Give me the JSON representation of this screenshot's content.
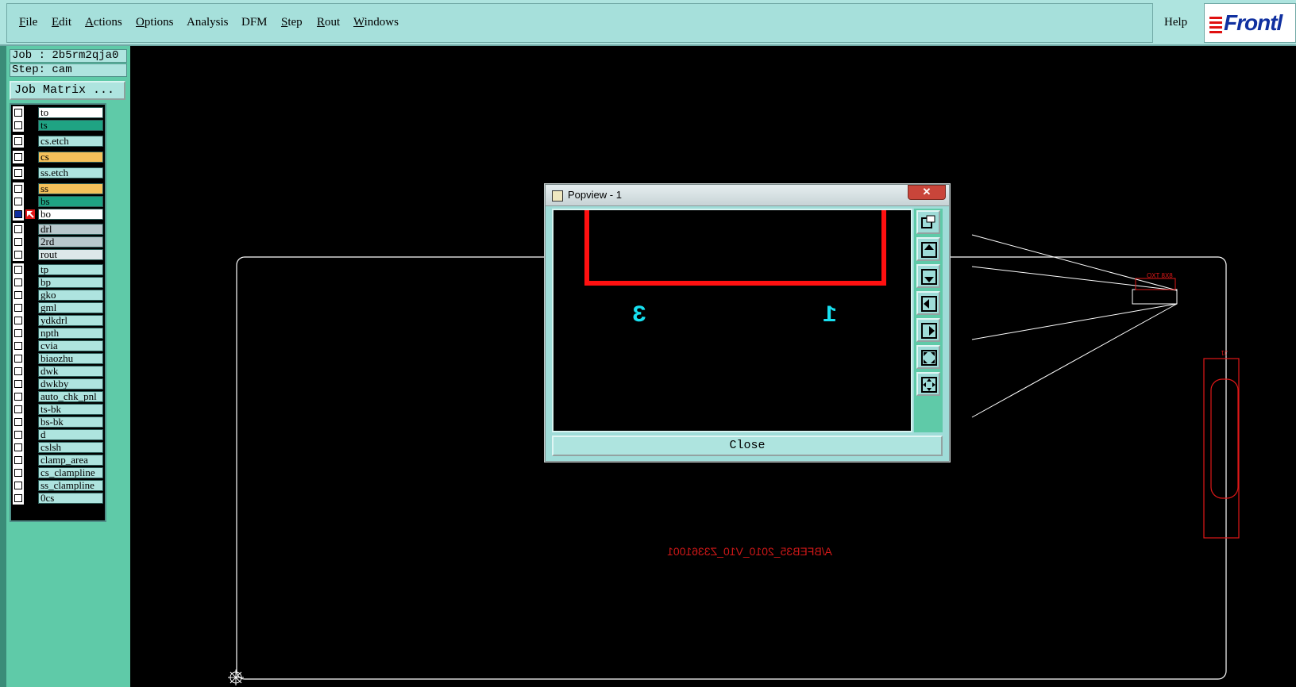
{
  "menubar": {
    "items": [
      {
        "label": "File",
        "u": "F",
        "rest": "ile"
      },
      {
        "label": "Edit",
        "u": "E",
        "rest": "dit"
      },
      {
        "label": "Actions",
        "u": "A",
        "rest": "ctions"
      },
      {
        "label": "Options",
        "u": "O",
        "rest": "ptions"
      },
      {
        "label": "Analysis",
        "u": "",
        "rest": "Analysis"
      },
      {
        "label": "DFM",
        "u": "",
        "rest": "DFM"
      },
      {
        "label": "Step",
        "u": "S",
        "rest": "tep"
      },
      {
        "label": "Rout",
        "u": "R",
        "rest": "out"
      },
      {
        "label": "Windows",
        "u": "W",
        "rest": "indows"
      }
    ],
    "help": "Help",
    "logo_text": "Frontl"
  },
  "job": {
    "job_line": "Job : 2b5rm2qja0",
    "step_line": "Step: cam",
    "matrix_button": "Job Matrix ..."
  },
  "layers": [
    {
      "name": "to",
      "color": "#ffffff"
    },
    {
      "name": "ts",
      "color": "#1fa383"
    },
    {
      "name": "cs.etch",
      "color": "#aee4df"
    },
    {
      "name": "cs",
      "color": "#f5c15a"
    },
    {
      "name": "ss.etch",
      "color": "#aee4df"
    },
    {
      "name": "ss",
      "color": "#f5c15a"
    },
    {
      "name": "bs",
      "color": "#1fa383"
    },
    {
      "name": "bo",
      "color": "#ffffff",
      "active": true
    },
    {
      "name": "drl",
      "color": "#b8c8cc"
    },
    {
      "name": "2rd",
      "color": "#b8c8cc"
    },
    {
      "name": "rout",
      "color": "#dce8ea"
    },
    {
      "name": "tp",
      "color": "#aee4df"
    },
    {
      "name": "bp",
      "color": "#aee4df"
    },
    {
      "name": "gko",
      "color": "#aee4df"
    },
    {
      "name": "gml",
      "color": "#aee4df"
    },
    {
      "name": "ydkdrl",
      "color": "#aee4df"
    },
    {
      "name": "npth",
      "color": "#aee4df"
    },
    {
      "name": "cvia",
      "color": "#aee4df"
    },
    {
      "name": "biaozhu",
      "color": "#aee4df"
    },
    {
      "name": "dwk",
      "color": "#aee4df"
    },
    {
      "name": "dwkby",
      "color": "#aee4df"
    },
    {
      "name": "auto_chk_pnl",
      "color": "#aee4df"
    },
    {
      "name": "ts-bk",
      "color": "#aee4df"
    },
    {
      "name": "bs-bk",
      "color": "#aee4df"
    },
    {
      "name": "d",
      "color": "#aee4df"
    },
    {
      "name": "cslsh",
      "color": "#aee4df"
    },
    {
      "name": "clamp_area",
      "color": "#aee4df"
    },
    {
      "name": "cs_clampline",
      "color": "#aee4df"
    },
    {
      "name": "ss_clampline",
      "color": "#aee4df"
    },
    {
      "name": "0cs",
      "color": "#aee4df"
    }
  ],
  "canvas": {
    "board_text": "A/BFEB35_2010_V10_Z3361001",
    "outline_color": "#ffffff",
    "feature_color": "#e01818",
    "label_small_1": "OXT 8X8",
    "label_small_2": "J1"
  },
  "popview": {
    "title": "Popview - 1",
    "close_label": "Close",
    "close_x": "✕",
    "pad_labels": [
      "3",
      "1"
    ],
    "pad_label_color": "#18e0f0",
    "tools": [
      "zoom-window-icon",
      "pan-up-icon",
      "pan-down-icon",
      "pan-left-icon",
      "pan-right-icon",
      "zoom-fit-icon",
      "zoom-home-icon"
    ]
  }
}
